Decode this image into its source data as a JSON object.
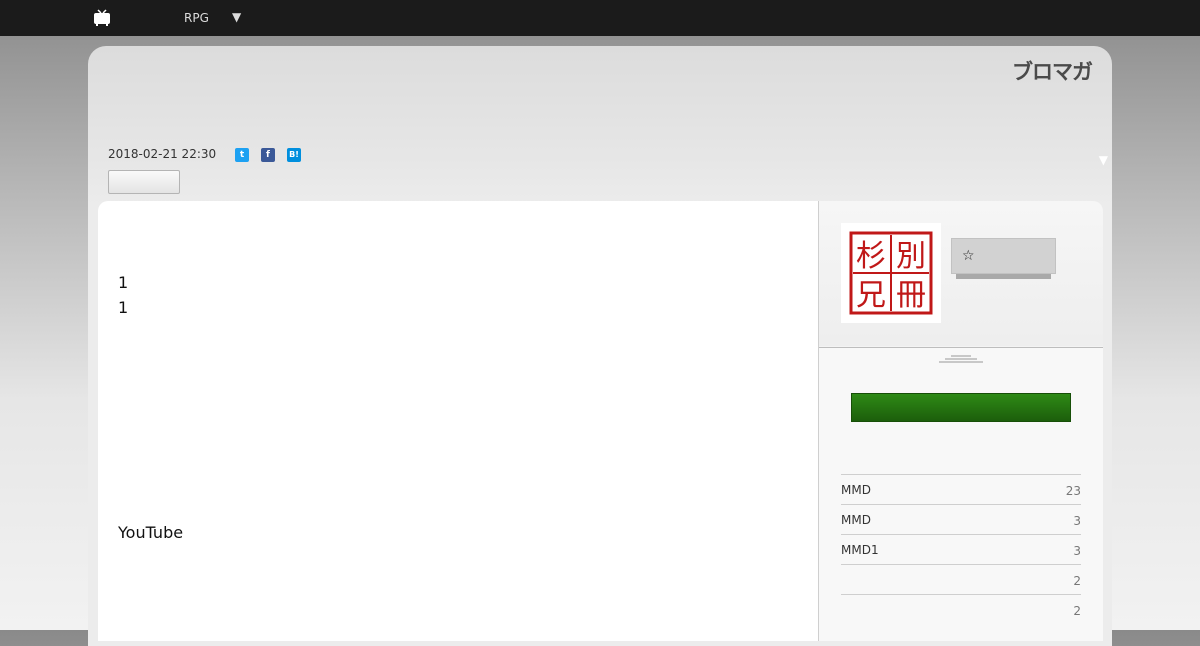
{
  "topbar": {
    "label": "RPG",
    "menu_arrow": "▼",
    "icon": "tv-icon"
  },
  "header": {
    "logo_text": "ブロマガ",
    "side_arrow": "▼"
  },
  "post": {
    "date": "2018-02-21 22:30",
    "share": [
      {
        "name": "twitter-icon",
        "glyph": "t",
        "color": "#1da1f2"
      },
      {
        "name": "facebook-icon",
        "glyph": "f",
        "color": "#3b5998"
      },
      {
        "name": "hatena-bookmark-icon",
        "glyph": "B!",
        "color": "#008fde"
      }
    ],
    "body_lines": [
      "1",
      "1",
      "YouTube"
    ]
  },
  "sidebar": {
    "avatar_seal_chars": [
      "別",
      "冊",
      "杉",
      "兄"
    ],
    "follow_icon": "star-icon",
    "star_glyph": "☆",
    "tags": [
      {
        "name": "MMD",
        "count": "23"
      },
      {
        "name": "MMD",
        "count": "3"
      },
      {
        "name": "MMD1",
        "count": "3"
      },
      {
        "name": "",
        "count": "2"
      },
      {
        "name": "",
        "count": "2"
      }
    ]
  },
  "colors": {
    "topbar": "#1b1b1b",
    "green_button": "#1f6a0d",
    "seal_red": "#c01818"
  }
}
